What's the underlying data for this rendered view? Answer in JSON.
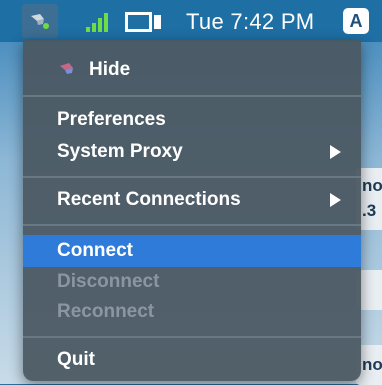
{
  "menubar": {
    "clock": "Tue 7:42 PM",
    "input_badge": "A"
  },
  "menu": {
    "hide_label": "Hide",
    "preferences_label": "Preferences",
    "system_proxy_label": "System Proxy",
    "recent_connections_label": "Recent Connections",
    "connect_label": "Connect",
    "disconnect_label": "Disconnect",
    "reconnect_label": "Reconnect",
    "quit_label": "Quit"
  },
  "background": {
    "snippet_1": "no",
    "snippet_2": ".3",
    "snippet_3": "no"
  },
  "colors": {
    "menubar": "#1d6fa4",
    "menu_bg": "#4a5862",
    "highlight": "#2f7bd9",
    "signal": "#6fdc45",
    "disabled_text": "#8b97a0"
  }
}
